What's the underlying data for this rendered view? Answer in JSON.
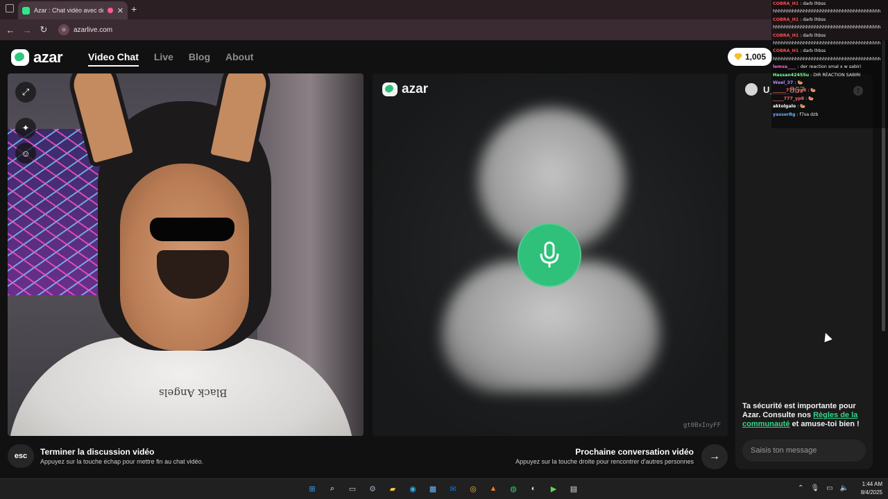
{
  "browser": {
    "tab_title": "Azar : Chat vidéo avec de n",
    "tab_close": "✕",
    "new_tab": "+",
    "url": "azarlive.com",
    "url_badge": "⊙",
    "nav": {
      "back": "←",
      "forward": "→",
      "reload": "↻"
    }
  },
  "site": {
    "logo_text": "azar",
    "nav": [
      {
        "label": "Video Chat",
        "active": true
      },
      {
        "label": "Live",
        "active": false
      },
      {
        "label": "Blog",
        "active": false
      },
      {
        "label": "About",
        "active": false
      }
    ],
    "gems": "1,005"
  },
  "left_video": {
    "shirt_text": "Black Angels",
    "buttons": {
      "expand": "⤢",
      "effects": "✦",
      "sticker": "☺"
    }
  },
  "right_video": {
    "logo_text": "azar",
    "code": "gt0BxInyFF"
  },
  "chat_panel": {
    "username": "U____867",
    "report_icon": "!",
    "safety_pre": "Ta sécurité est importante pour Azar. Consulte nos ",
    "safety_link": "Règles de la communauté",
    "safety_post": " et amuse-toi bien !",
    "input_placeholder": "Saisis ton message"
  },
  "bottom_bar": {
    "esc_label": "esc",
    "end_title": "Terminer la discussion vidéo",
    "end_sub": "Appuyez sur la touche échap pour mettre fin au chat vidéo.",
    "next_title": "Prochaine conversation vidéo",
    "next_sub": "Appuyez sur la touche droite pour rencontrer d'autres personnes",
    "next_icon": "→"
  },
  "stream_chat": [
    {
      "name": "COBRA_H1",
      "text": ": darb lhbss",
      "color": "#ff4d4d"
    },
    {
      "name": "",
      "text": "hhhhhhhhhhhhhhhhhhhhhhhhhhhhhhhhhhhhhhh",
      "color": "#ffffff"
    },
    {
      "name": "COBRA_H1",
      "text": ": darb lhbss",
      "color": "#ff4d4d"
    },
    {
      "name": "",
      "text": "hhhhhhhhhhhhhhhhhhhhhhhhhhhhhhhhhhhhhhh",
      "color": "#ffffff"
    },
    {
      "name": "COBRA_H1",
      "text": ": darb lhbss",
      "color": "#ff4d4d"
    },
    {
      "name": "",
      "text": "hhhhhhhhhhhhhhhhhhhhhhhhhhhhhhhhhhhhhhh",
      "color": "#ffffff"
    },
    {
      "name": "COBRA_H1",
      "text": ": darb lhbss",
      "color": "#ff4d4d"
    },
    {
      "name": "",
      "text": "hhhhhhhhhhhhhhhhhhhhhhhhhhhhhhhhhhhhhhh",
      "color": "#ffffff"
    },
    {
      "name": "lemsa____",
      "text": ": der reaction smal x w sabiri",
      "color": "#ff66cc"
    },
    {
      "name": "Hassan42455u",
      "text": ": DIR RÉACTION SABIRI",
      "color": "#7dff9a"
    },
    {
      "name": "Wael_37",
      "text": ": 🍉",
      "color": "#b388ff"
    },
    {
      "name": "",
      "text": "",
      "color": "#ffffff"
    },
    {
      "name": "______777_yp8",
      "text": ": 🍉",
      "color": "#ff6b6b"
    },
    {
      "name": "_____777_yp8",
      "text": ": 🍉",
      "color": "#ff6b6b"
    },
    {
      "name": "aktolgalo",
      "text": ": 🍉",
      "color": "#ffffff"
    },
    {
      "name": "yasserBg",
      "text": ": f7sa dzb",
      "color": "#66b3ff"
    }
  ],
  "taskbar": {
    "icons": [
      {
        "name": "windows-start-icon",
        "glyph": "⊞",
        "color": "#3aa0ff"
      },
      {
        "name": "search-icon",
        "glyph": "⌕",
        "color": "#ffffff"
      },
      {
        "name": "task-view-icon",
        "glyph": "▭",
        "color": "#cccccc"
      },
      {
        "name": "settings-icon",
        "glyph": "⚙",
        "color": "#9ab"
      },
      {
        "name": "file-explorer-icon",
        "glyph": "▰",
        "color": "#f5c542"
      },
      {
        "name": "edge-icon",
        "glyph": "◉",
        "color": "#2fb1e8"
      },
      {
        "name": "store-icon",
        "glyph": "▦",
        "color": "#6bb7ff"
      },
      {
        "name": "outlook-icon",
        "glyph": "✉",
        "color": "#1a73d9"
      },
      {
        "name": "chrome-icon",
        "glyph": "◎",
        "color": "#f0b52c"
      },
      {
        "name": "app-icon-orange",
        "glyph": "▲",
        "color": "#f07a2b"
      },
      {
        "name": "spotify-icon",
        "glyph": "◍",
        "color": "#1ed760"
      },
      {
        "name": "obs-icon",
        "glyph": "◐",
        "color": "#dddddd"
      },
      {
        "name": "app-icon-green",
        "glyph": "▶",
        "color": "#5ad65a"
      },
      {
        "name": "window-icon",
        "glyph": "▤",
        "color": "#dddddd"
      }
    ],
    "tray": {
      "up": "⌃",
      "mic": "🎙",
      "monitor": "▭",
      "volume": "🔈"
    },
    "time": "1:44 AM",
    "date": "8/4/2025"
  },
  "colors": {
    "accent": "#2fc07a",
    "link": "#33d689",
    "bg": "#111111"
  }
}
